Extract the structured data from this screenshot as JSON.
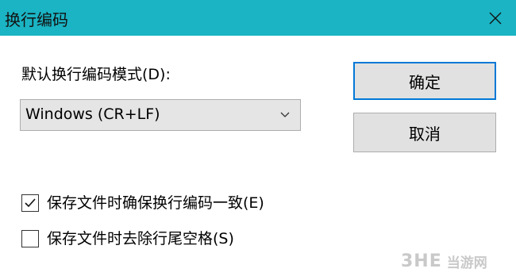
{
  "window": {
    "title": "换行编码"
  },
  "form": {
    "mode_label": "默认换行编码模式(D):",
    "mode_select": {
      "selected": "Windows (CR+LF)"
    }
  },
  "buttons": {
    "ok": "确定",
    "cancel": "取消"
  },
  "options": [
    {
      "label": "保存文件时确保换行编码一致(E)",
      "checked": true
    },
    {
      "label": "保存文件时去除行尾空格(S)",
      "checked": false
    }
  ],
  "watermark": {
    "logo": "3HE",
    "text": "当游网"
  },
  "colors": {
    "titlebar": "#1ab4c4",
    "focus_border": "#0078d7",
    "button_bg": "#e1e1e1"
  },
  "icons": {
    "close": "close-icon",
    "dropdown": "chevron-down-icon",
    "check": "check-icon"
  }
}
